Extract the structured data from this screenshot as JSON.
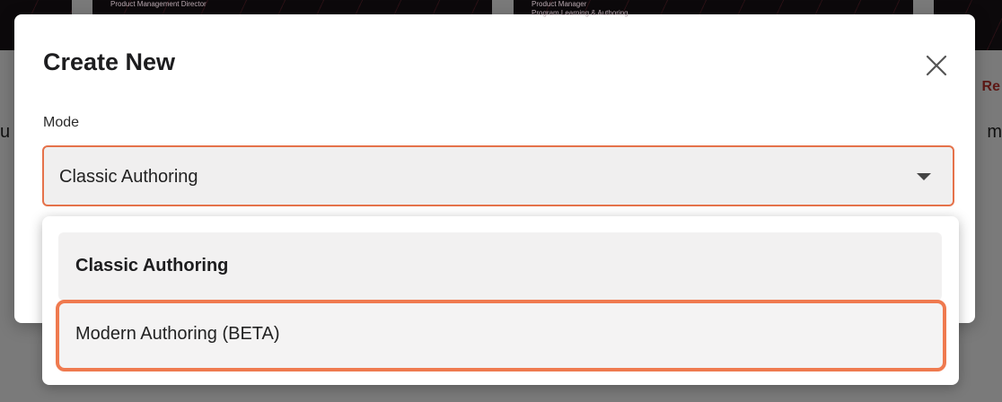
{
  "background": {
    "card_captions": [
      "Product Management Director",
      "Product Manager\nProgram Learning & Authoring"
    ],
    "edge_text_left": "u",
    "edge_text_right": "m",
    "edge_text_red": "Re"
  },
  "modal": {
    "title": "Create New",
    "close_icon": "close-icon",
    "mode_label": "Mode",
    "select": {
      "value": "Classic Authoring",
      "caret_icon": "caret-down-icon"
    }
  },
  "dropdown": {
    "options": [
      {
        "label": "Classic Authoring",
        "selected": true
      },
      {
        "label": "Modern Authoring (BETA)",
        "highlighted": true
      }
    ]
  },
  "colors": {
    "accent": "#e5724a",
    "highlight_border": "#ef7a4f",
    "field_bg": "#f0efef"
  }
}
